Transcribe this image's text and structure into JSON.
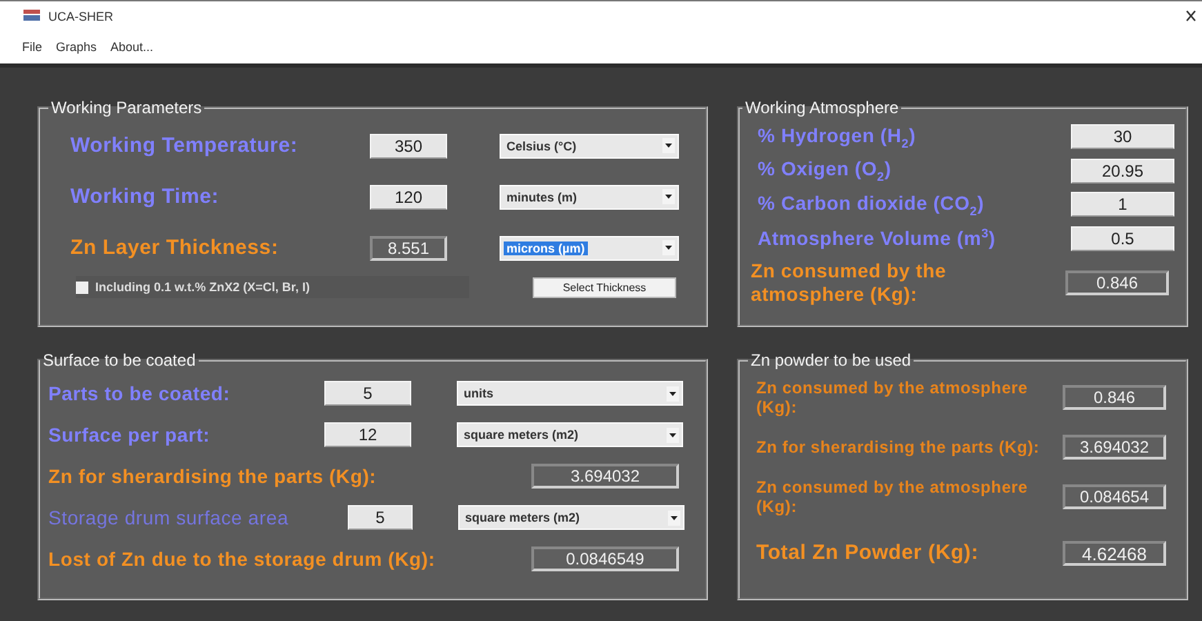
{
  "window": {
    "title": "UCA-SHER"
  },
  "menu": [
    {
      "label": "File"
    },
    {
      "label": "Graphs"
    },
    {
      "label": "About..."
    }
  ],
  "panels": [
    {
      "title": "Working Parameters",
      "rows": [
        {
          "kind": "input",
          "label": "Working Temperature:",
          "value": "350",
          "unit": "Celsius (°C)",
          "unit_selected": false
        },
        {
          "kind": "input",
          "label": "Working Time:",
          "value": "120",
          "unit": "minutes (m)",
          "unit_selected": false
        },
        {
          "kind": "result",
          "label": "Zn Layer Thickness:",
          "value": "8.551",
          "unit": "microns (µm)",
          "unit_selected": true
        }
      ],
      "option": {
        "label": "Including 0.1 w.t.%  ZnX2 (X=Cl, Br, I)",
        "checked": false
      },
      "button": "Select Thickness"
    },
    {
      "title": "Working Atmosphere",
      "rows": [
        {
          "kind": "input",
          "label": "% Hydrogen (H$_{2}$)",
          "value": "30"
        },
        {
          "kind": "input",
          "label": "% Oxigen (O$_{2}$)",
          "value": "20.95"
        },
        {
          "kind": "input",
          "label": "% Carbon dioxide (CO$_{2}$)",
          "value": "1"
        },
        {
          "kind": "input",
          "label": "Atmosphere Volume (m$^{3}$)",
          "value": "0.5"
        },
        {
          "kind": "result",
          "label": "Zn consumed by the atmosphere (Kg):",
          "value": "0.846"
        }
      ]
    },
    {
      "title": "Surface to be coated",
      "rows": [
        {
          "kind": "input",
          "label": "Parts to be coated:",
          "value": "5",
          "unit": "units",
          "unit_selected": false
        },
        {
          "kind": "input",
          "label": "Surface per part:",
          "value": "12",
          "unit": "square meters (m2)",
          "unit_selected": false
        },
        {
          "kind": "result",
          "label": "Zn for sherardising the parts (Kg):",
          "value": "3.694032"
        },
        {
          "kind": "minor",
          "label": "Storage drum surface area",
          "value": "5",
          "unit": "square meters (m2)",
          "unit_selected": false
        },
        {
          "kind": "result",
          "label": "Lost of Zn due to the storage drum (Kg):",
          "value": "0.0846549"
        }
      ]
    },
    {
      "title": "Zn powder to be used",
      "rows": [
        {
          "kind": "note",
          "label": "Zn consumed by the atmosphere (Kg):",
          "value": "0.846"
        },
        {
          "kind": "note",
          "label": "Zn for sherardising the parts (Kg):",
          "value": "3.694032"
        },
        {
          "kind": "note",
          "label": "Zn consumed by the atmosphere (Kg):",
          "value": "0.084654"
        },
        {
          "kind": "total",
          "label": "Total Zn Powder (Kg):",
          "value": "4.62468"
        }
      ]
    }
  ]
}
